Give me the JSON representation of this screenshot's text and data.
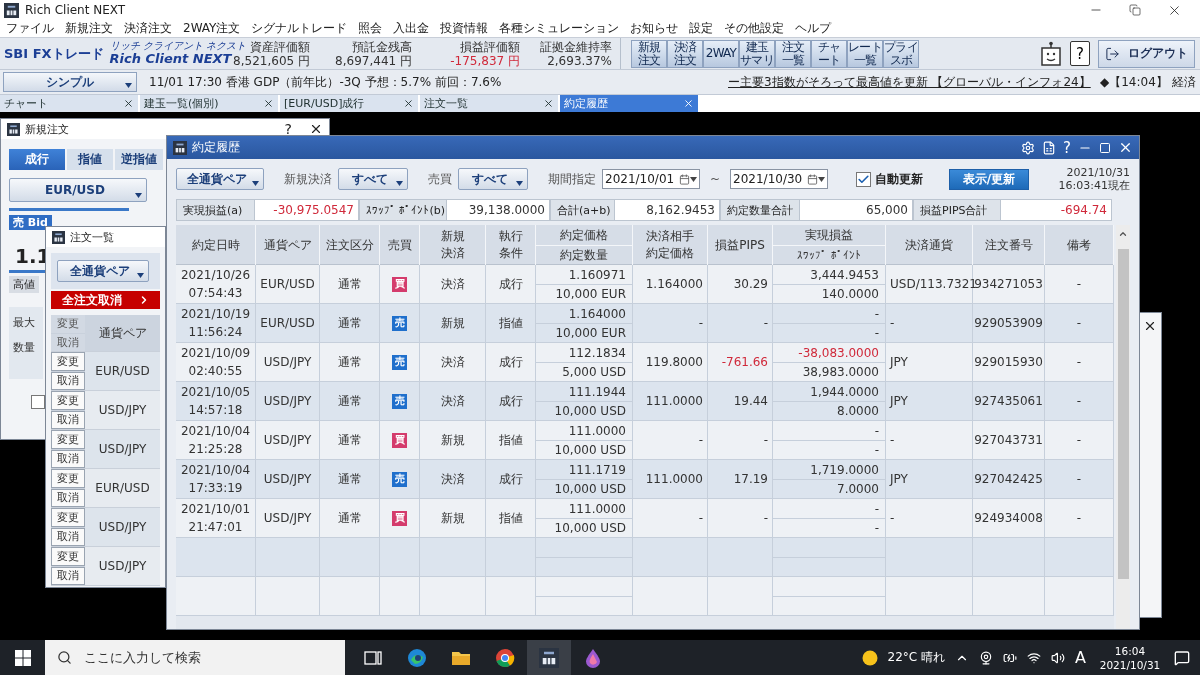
{
  "window": {
    "title": "Rich Client NEXT"
  },
  "menu": [
    "ファイル",
    "新規注文",
    "決済注文",
    "2WAY注文",
    "シグナルトレード",
    "照会",
    "入出金",
    "投資情報",
    "各種シミュレーション",
    "お知らせ",
    "設定",
    "その他設定",
    "ヘルプ"
  ],
  "header": {
    "brand": "SBI FXトレード",
    "logo_ruby": "リッチ クライアント ネクスト",
    "logo": "Rich Client NEXT",
    "stats": [
      {
        "label": "資産評価額",
        "value": "8,521,605 円",
        "loss": false
      },
      {
        "label": "預託金残高",
        "value": "8,697,441 円",
        "loss": false
      },
      {
        "label": "損益評価額",
        "value": "-175,837 円",
        "loss": true
      },
      {
        "label": "証拠金維持率",
        "value": "2,693.37%",
        "loss": false
      }
    ],
    "tools": [
      {
        "lines": [
          "新規",
          "注文"
        ]
      },
      {
        "lines": [
          "決済",
          "注文"
        ]
      },
      {
        "lines": [
          "2WAY"
        ]
      },
      {
        "lines": [
          "建玉",
          "サマリ"
        ]
      },
      {
        "lines": [
          "注文",
          "一覧"
        ]
      },
      {
        "lines": [
          "チャ",
          "ート"
        ]
      },
      {
        "lines": [
          "レート",
          "一覧"
        ]
      },
      {
        "lines": [
          "プライ",
          "スボ"
        ]
      }
    ],
    "help": "?",
    "logout": "ログアウト"
  },
  "ticker": {
    "mode": "シンプル",
    "news": [
      "11/01 17:30 香港 GDP（前年比）-3Q 予想：5.7% 前回：7.6%",
      "ー主要3指数がそろって最高値を更新 【グローバル・インフォ24】",
      "◆【14:04】 経済"
    ]
  },
  "tabs": [
    {
      "label": "チャート",
      "selected": false
    },
    {
      "label": "建玉一覧(個別)",
      "selected": false
    },
    {
      "label": "[EUR/USD]成行",
      "selected": false
    },
    {
      "label": "注文一覧",
      "selected": false
    },
    {
      "label": "約定履歴",
      "selected": true
    }
  ],
  "new_order": {
    "title": "新規注文",
    "help": "?",
    "tabs": [
      {
        "label": "成行",
        "selected": true
      },
      {
        "label": "指値",
        "selected": false
      },
      {
        "label": "逆指値",
        "selected": false
      }
    ],
    "pair": "EUR/USD",
    "side_label": "売 Bid",
    "price": "1.1",
    "high_label": "高値",
    "max_label": "最大",
    "qty_label": "数量",
    "option_checked": false
  },
  "order_list": {
    "title": "注文一覧",
    "filter": "全通貨ペア",
    "cancel_all": "全注文取消",
    "header_action": [
      "変更",
      "取消"
    ],
    "header_pair": "通貨ペア",
    "rows": [
      {
        "pair": "EUR/USD",
        "edit": "変更",
        "cancel": "取消"
      },
      {
        "pair": "USD/JPY",
        "edit": "変更",
        "cancel": "取消"
      },
      {
        "pair": "USD/JPY",
        "edit": "変更",
        "cancel": "取消"
      },
      {
        "pair": "EUR/USD",
        "edit": "変更",
        "cancel": "取消"
      },
      {
        "pair": "USD/JPY",
        "edit": "変更",
        "cancel": "取消"
      },
      {
        "pair": "USD/JPY",
        "edit": "変更",
        "cancel": "取消"
      }
    ]
  },
  "history": {
    "title": "約定履歴",
    "help": "?",
    "filters": {
      "pair": "全通貨ペア",
      "open_close_label": "新規決済",
      "open_close": "すべて",
      "side_label": "売買",
      "side": "すべて",
      "period_label": "期間指定",
      "from": "2021/10/01",
      "tilde": "~",
      "to": "2021/10/30",
      "auto_refresh": {
        "label": "自動更新",
        "checked": true
      },
      "refresh": "表示/更新",
      "as_of": "2021/10/31 16:03:41現在"
    },
    "summary": [
      {
        "label": "実現損益(a)",
        "value": "-30,975.0547",
        "loss": true
      },
      {
        "label": "ｽﾜｯﾌﾟ ﾎﾟｲﾝﾄ(b)",
        "value": "39,138.0000",
        "loss": false
      },
      {
        "label": "合計(a+b)",
        "value": "8,162.9453",
        "loss": false
      },
      {
        "label": "約定数量合計",
        "value": "65,000",
        "loss": false
      },
      {
        "label": "損益PIPS合計",
        "value": "-694.74",
        "loss": true
      }
    ],
    "columns": [
      {
        "lines": [
          "約定日時"
        ],
        "split": false
      },
      {
        "lines": [
          "通貨ペア"
        ],
        "split": false
      },
      {
        "lines": [
          "注文区分"
        ],
        "split": false
      },
      {
        "lines": [
          "売買"
        ],
        "split": false
      },
      {
        "lines": [
          "新規",
          "決済"
        ],
        "split": false
      },
      {
        "lines": [
          "執行",
          "条件"
        ],
        "split": false
      },
      {
        "lines": [
          "約定価格",
          "約定数量"
        ],
        "split": true
      },
      {
        "lines": [
          "決済相手",
          "約定価格"
        ],
        "split": false
      },
      {
        "lines": [
          "損益PIPS"
        ],
        "split": false
      },
      {
        "lines": [
          "実現損益",
          "ｽﾜｯﾌﾟ ﾎﾟｲﾝﾄ"
        ],
        "split": true
      },
      {
        "lines": [
          "決済通貨"
        ],
        "split": false
      },
      {
        "lines": [
          "注文番号"
        ],
        "split": false
      },
      {
        "lines": [
          "備考"
        ],
        "split": false
      }
    ],
    "rows": [
      {
        "time": "2021/10/26 07:54:43",
        "pair": "EUR/USD",
        "type": "通常",
        "side": {
          "label": "買",
          "kind": "buy"
        },
        "open_close": "決済",
        "exec": "成行",
        "price": "1.160971",
        "qty": "10,000 EUR",
        "counter_price": "1.164000",
        "pips": "30.29",
        "pips_loss": false,
        "pnl": "3,444.9453",
        "pnl_loss": false,
        "swap": "140.0000",
        "currency": "USD/113.7321",
        "order_no": "934271053",
        "note": "-"
      },
      {
        "time": "2021/10/19 11:56:24",
        "pair": "EUR/USD",
        "type": "通常",
        "side": {
          "label": "売",
          "kind": "sell"
        },
        "open_close": "新規",
        "exec": "指値",
        "price": "1.164000",
        "qty": "10,000 EUR",
        "counter_price": "-",
        "pips": "-",
        "pips_loss": false,
        "pnl": "-",
        "pnl_loss": false,
        "swap": "-",
        "currency": "-",
        "order_no": "929053909",
        "note": "-"
      },
      {
        "time": "2021/10/09 02:40:55",
        "pair": "USD/JPY",
        "type": "通常",
        "side": {
          "label": "売",
          "kind": "sell"
        },
        "open_close": "決済",
        "exec": "成行",
        "price": "112.1834",
        "qty": "5,000 USD",
        "counter_price": "119.8000",
        "pips": "-761.66",
        "pips_loss": true,
        "pnl": "-38,083.0000",
        "pnl_loss": true,
        "swap": "38,983.0000",
        "currency": "JPY",
        "order_no": "929015930",
        "note": "-"
      },
      {
        "time": "2021/10/05 14:57:18",
        "pair": "USD/JPY",
        "type": "通常",
        "side": {
          "label": "売",
          "kind": "sell"
        },
        "open_close": "決済",
        "exec": "成行",
        "price": "111.1944",
        "qty": "10,000 USD",
        "counter_price": "111.0000",
        "pips": "19.44",
        "pips_loss": false,
        "pnl": "1,944.0000",
        "pnl_loss": false,
        "swap": "8.0000",
        "currency": "JPY",
        "order_no": "927435061",
        "note": "-"
      },
      {
        "time": "2021/10/04 21:25:28",
        "pair": "USD/JPY",
        "type": "通常",
        "side": {
          "label": "買",
          "kind": "buy"
        },
        "open_close": "新規",
        "exec": "指値",
        "price": "111.0000",
        "qty": "10,000 USD",
        "counter_price": "-",
        "pips": "-",
        "pips_loss": false,
        "pnl": "-",
        "pnl_loss": false,
        "swap": "-",
        "currency": "-",
        "order_no": "927043731",
        "note": "-"
      },
      {
        "time": "2021/10/04 17:33:19",
        "pair": "USD/JPY",
        "type": "通常",
        "side": {
          "label": "売",
          "kind": "sell"
        },
        "open_close": "決済",
        "exec": "成行",
        "price": "111.1719",
        "qty": "10,000 USD",
        "counter_price": "111.0000",
        "pips": "17.19",
        "pips_loss": false,
        "pnl": "1,719.0000",
        "pnl_loss": false,
        "swap": "7.0000",
        "currency": "JPY",
        "order_no": "927042425",
        "note": "-"
      },
      {
        "time": "2021/10/01 21:47:01",
        "pair": "USD/JPY",
        "type": "通常",
        "side": {
          "label": "買",
          "kind": "buy"
        },
        "open_close": "新規",
        "exec": "指値",
        "price": "111.0000",
        "qty": "10,000 USD",
        "counter_price": "-",
        "pips": "-",
        "pips_loss": false,
        "pnl": "-",
        "pnl_loss": false,
        "swap": "-",
        "currency": "-",
        "order_no": "924934008",
        "note": "-"
      }
    ]
  },
  "taskbar": {
    "search_placeholder": "ここに入力して検索",
    "weather": "22°C 晴れ",
    "ime": "A",
    "clock": "16:04 2021/10/31"
  }
}
